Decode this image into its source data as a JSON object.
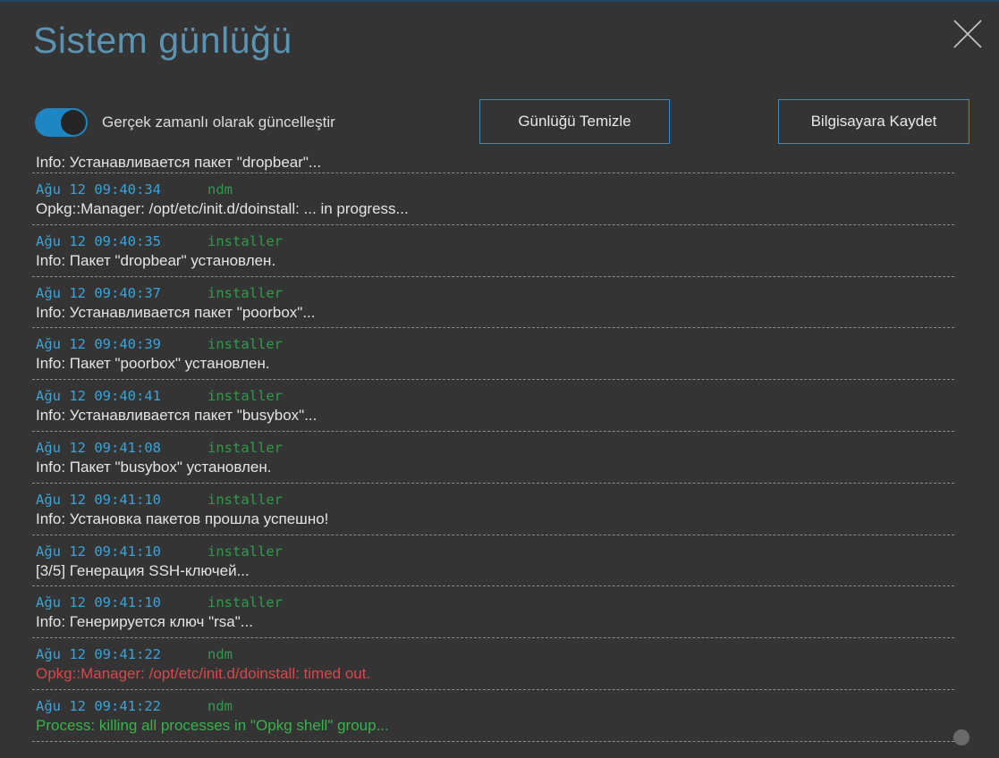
{
  "dialog": {
    "title": "Sistem günlüğü",
    "close_icon": "close-icon"
  },
  "controls": {
    "realtime_toggle": {
      "label": "Gerçek zamanlı olarak güncelleştir",
      "checked": true
    },
    "clear_button": "Günlüğü Temizle",
    "save_button": "Bilgisayara Kaydet"
  },
  "log": {
    "first_partial_message": "Info: Устанавливается пакет \"dropbear\"...",
    "entries": [
      {
        "timestamp": "Ağu 12 09:40:34",
        "source": "ndm",
        "message": "Opkg::Manager: /opt/etc/init.d/doinstall: ... in progress...",
        "level": "info"
      },
      {
        "timestamp": "Ağu 12 09:40:35",
        "source": "installer",
        "message": "Info: Пакет \"dropbear\" установлен.",
        "level": "info"
      },
      {
        "timestamp": "Ağu 12 09:40:37",
        "source": "installer",
        "message": "Info: Устанавливается пакет \"poorbox\"...",
        "level": "info"
      },
      {
        "timestamp": "Ağu 12 09:40:39",
        "source": "installer",
        "message": "Info: Пакет \"poorbox\" установлен.",
        "level": "info"
      },
      {
        "timestamp": "Ağu 12 09:40:41",
        "source": "installer",
        "message": "Info: Устанавливается пакет \"busybox\"...",
        "level": "info"
      },
      {
        "timestamp": "Ağu 12 09:41:08",
        "source": "installer",
        "message": "Info: Пакет \"busybox\" установлен.",
        "level": "info"
      },
      {
        "timestamp": "Ağu 12 09:41:10",
        "source": "installer",
        "message": "Info: Установка пакетов прошла успешно!",
        "level": "info"
      },
      {
        "timestamp": "Ağu 12 09:41:10",
        "source": "installer",
        "message": "[3/5] Генерация SSH-ключей...",
        "level": "info"
      },
      {
        "timestamp": "Ağu 12 09:41:10",
        "source": "installer",
        "message": "Info: Генерируется ключ \"rsa\"...",
        "level": "info"
      },
      {
        "timestamp": "Ağu 12 09:41:22",
        "source": "ndm",
        "message": "Opkg::Manager: /opt/etc/init.d/doinstall: timed out.",
        "level": "error"
      },
      {
        "timestamp": "Ağu 12 09:41:22",
        "source": "ndm",
        "message": "Process: killing all processes in \"Opkg shell\" group...",
        "level": "success"
      }
    ]
  },
  "colors": {
    "background": "#343434",
    "title": "#5b93b3",
    "accent": "#1e86c2",
    "timestamp": "#3ba3d8",
    "source": "#2f9b4a",
    "error": "#d9474c",
    "success": "#38b24b"
  }
}
